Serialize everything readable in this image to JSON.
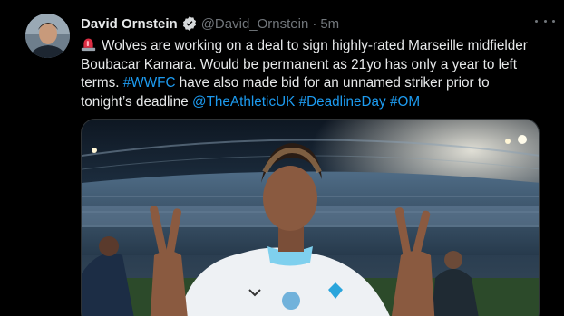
{
  "tweet": {
    "author_name": "David Ornstein",
    "handle": "@David_Ornstein",
    "separator": "·",
    "time": "5m",
    "text_segments": [
      {
        "kind": "text",
        "value": "Wolves are working on a deal to sign highly-rated Marseille midfielder Boubacar Kamara. Would be permanent as 21yo has only a year to left terms. "
      },
      {
        "kind": "link",
        "value": "#WWFC"
      },
      {
        "kind": "text",
        "value": " have also made bid for an unnamed striker prior to tonight’s deadline "
      },
      {
        "kind": "link",
        "value": "@TheAthleticUK"
      },
      {
        "kind": "text",
        "value": " "
      },
      {
        "kind": "link",
        "value": "#DeadlineDay"
      },
      {
        "kind": "text",
        "value": " "
      },
      {
        "kind": "link",
        "value": "#OM"
      }
    ],
    "lead_icon": "police-siren-emoji",
    "verified_icon": "verified-badge-icon",
    "more_icon": "more-options-icon"
  },
  "colors": {
    "background": "#000000",
    "text": "#e7e9ea",
    "secondary": "#71767b",
    "link": "#1d9bf0"
  }
}
